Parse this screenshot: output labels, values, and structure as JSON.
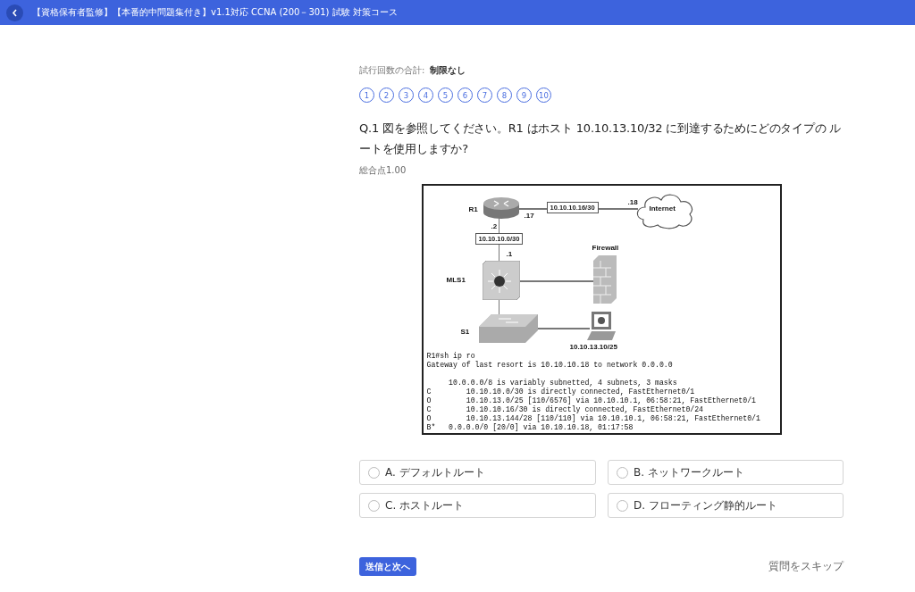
{
  "header": {
    "title": "【資格保有者監修】【本番的中問題集付き】v1.1対応 CCNA (200－301) 試験 対策コース"
  },
  "attempts": {
    "label": "試行回数の合計:",
    "value": "制限なし"
  },
  "question_numbers": [
    "1",
    "2",
    "3",
    "4",
    "5",
    "6",
    "7",
    "8",
    "9",
    "10"
  ],
  "question": "Q.1 図を参照してください。R1 はホスト 10.10.13.10/32 に到達するためにどのタイプの ルートを使用しますか?",
  "points": "総合点1.00",
  "figure": {
    "labels": {
      "r1": "R1",
      "r1_wan": ".17",
      "r1_lan": ".2",
      "wan_net": "10.10.10.16/30",
      "isp": ".18",
      "internet": "Internet",
      "lan_net": "10.10.10.0/30",
      "mls_ip": ".1",
      "mls": "MLS1",
      "firewall": "Firewall",
      "s1": "S1",
      "host": "10.10.13.10/25"
    },
    "output": [
      "R1#sh ip ro",
      "Gateway of last resort is 10.10.10.18 to network 0.0.0.0",
      "     10.0.0.0/8 is variably subnetted, 4 subnets, 3 masks",
      "C        10.10.10.0/30 is directly connected, FastEthernet0/1",
      "O        10.10.13.0/25 [110/6576] via 10.10.10.1, 06:58:21, FastEthernet0/1",
      "C        10.10.10.16/30 is directly connected, FastEthernet0/24",
      "O        10.10.13.144/28 [110/110] via 10.10.10.1, 06:58:21, FastEthernet0/1",
      "B*   0.0.0.0/0 [20/0] via 10.10.10.18, 01:17:58"
    ]
  },
  "options": [
    {
      "label": "A. デフォルトルート",
      "selected": false
    },
    {
      "label": "B. ネットワークルート",
      "selected": false
    },
    {
      "label": "C. ホストルート",
      "selected": false
    },
    {
      "label": "D. フローティング静的ルート",
      "selected": false
    }
  ],
  "submit_button": "送信と次へ",
  "skip_link": "質問をスキップ"
}
